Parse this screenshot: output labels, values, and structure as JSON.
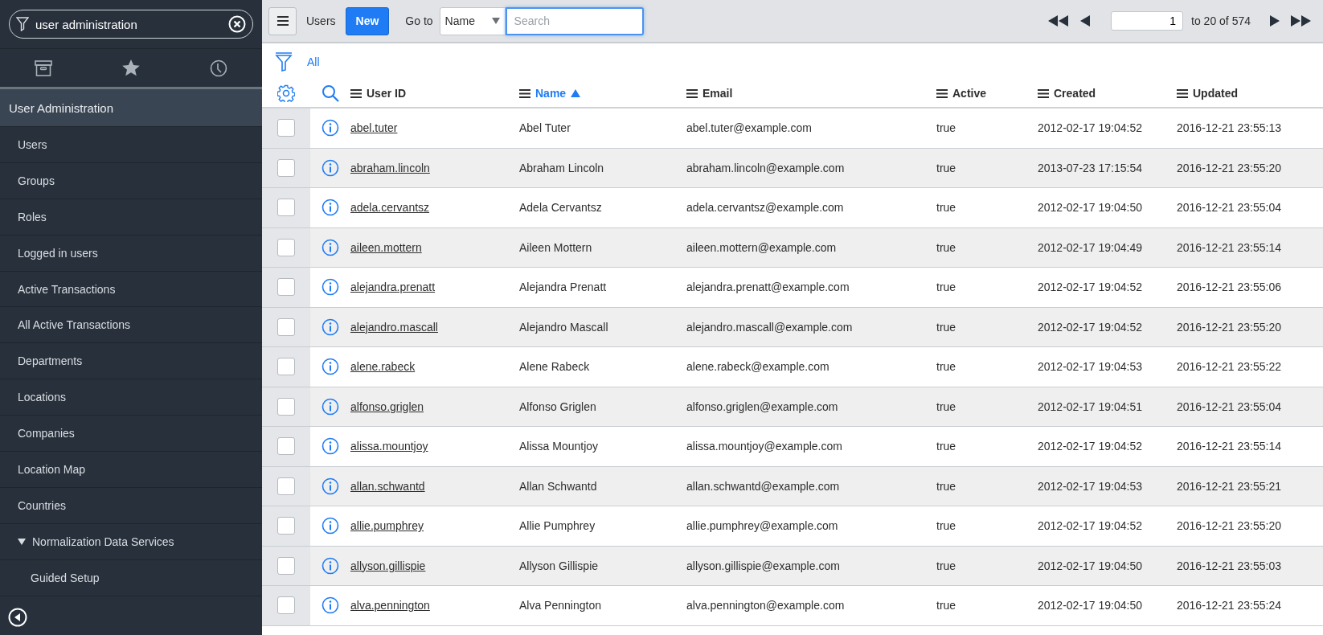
{
  "sidebar": {
    "filter": {
      "value": "user administration"
    },
    "application": {
      "label": "User Administration",
      "selected": true,
      "items": [
        {
          "label": "Users"
        },
        {
          "label": "Groups"
        },
        {
          "label": "Roles"
        },
        {
          "label": "Logged in users"
        },
        {
          "label": "Active Transactions"
        },
        {
          "label": "All Active Transactions"
        },
        {
          "label": "Departments"
        },
        {
          "label": "Locations"
        },
        {
          "label": "Companies"
        },
        {
          "label": "Location Map"
        },
        {
          "label": "Countries"
        },
        {
          "label": "Normalization Data Services",
          "expanded": true,
          "children": [
            {
              "label": "Guided Setup"
            }
          ]
        }
      ]
    }
  },
  "toolbar": {
    "title": "Users",
    "new_button": "New",
    "goto_label": "Go to",
    "goto_field": "Name",
    "search": {
      "placeholder": "Search"
    },
    "page": "1",
    "range": "to 20 of 574"
  },
  "breadcrumb": "All",
  "table": {
    "columns": [
      {
        "label": "User ID",
        "sorted": false
      },
      {
        "label": "Name",
        "sorted": true
      },
      {
        "label": "Email",
        "sorted": false
      },
      {
        "label": "Active",
        "sorted": false
      },
      {
        "label": "Created",
        "sorted": false
      },
      {
        "label": "Updated",
        "sorted": false
      }
    ],
    "rows": [
      {
        "checked": false,
        "cells": [
          "abel.tuter",
          "Abel Tuter",
          "abel.tuter@example.com",
          "true",
          "2012-02-17 19:04:52",
          "2016-12-21 23:55:13"
        ]
      },
      {
        "checked": false,
        "cells": [
          "abraham.lincoln",
          "Abraham Lincoln",
          "abraham.lincoln@example.com",
          "true",
          "2013-07-23 17:15:54",
          "2016-12-21 23:55:20"
        ]
      },
      {
        "checked": false,
        "cells": [
          "adela.cervantsz",
          "Adela Cervantsz",
          "adela.cervantsz@example.com",
          "true",
          "2012-02-17 19:04:50",
          "2016-12-21 23:55:04"
        ]
      },
      {
        "checked": false,
        "cells": [
          "aileen.mottern",
          "Aileen Mottern",
          "aileen.mottern@example.com",
          "true",
          "2012-02-17 19:04:49",
          "2016-12-21 23:55:14"
        ]
      },
      {
        "checked": false,
        "cells": [
          "alejandra.prenatt",
          "Alejandra Prenatt",
          "alejandra.prenatt@example.com",
          "true",
          "2012-02-17 19:04:52",
          "2016-12-21 23:55:06"
        ]
      },
      {
        "checked": false,
        "cells": [
          "alejandro.mascall",
          "Alejandro Mascall",
          "alejandro.mascall@example.com",
          "true",
          "2012-02-17 19:04:52",
          "2016-12-21 23:55:20"
        ]
      },
      {
        "checked": false,
        "cells": [
          "alene.rabeck",
          "Alene Rabeck",
          "alene.rabeck@example.com",
          "true",
          "2012-02-17 19:04:53",
          "2016-12-21 23:55:22"
        ]
      },
      {
        "checked": false,
        "cells": [
          "alfonso.griglen",
          "Alfonso Griglen",
          "alfonso.griglen@example.com",
          "true",
          "2012-02-17 19:04:51",
          "2016-12-21 23:55:04"
        ]
      },
      {
        "checked": false,
        "cells": [
          "alissa.mountjoy",
          "Alissa Mountjoy",
          "alissa.mountjoy@example.com",
          "true",
          "2012-02-17 19:04:52",
          "2016-12-21 23:55:14"
        ]
      },
      {
        "checked": false,
        "cells": [
          "allan.schwantd",
          "Allan Schwantd",
          "allan.schwantd@example.com",
          "true",
          "2012-02-17 19:04:53",
          "2016-12-21 23:55:21"
        ]
      },
      {
        "checked": false,
        "cells": [
          "allie.pumphrey",
          "Allie Pumphrey",
          "allie.pumphrey@example.com",
          "true",
          "2012-02-17 19:04:52",
          "2016-12-21 23:55:20"
        ]
      },
      {
        "checked": false,
        "cells": [
          "allyson.gillispie",
          "Allyson Gillispie",
          "allyson.gillispie@example.com",
          "true",
          "2012-02-17 19:04:50",
          "2016-12-21 23:55:03"
        ]
      },
      {
        "checked": false,
        "cells": [
          "alva.pennington",
          "Alva Pennington",
          "alva.pennington@example.com",
          "true",
          "2012-02-17 19:04:50",
          "2016-12-21 23:55:24"
        ]
      }
    ]
  }
}
